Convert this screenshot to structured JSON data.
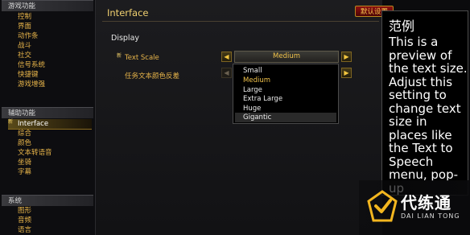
{
  "sidebar": {
    "section1": {
      "title": "游戏功能",
      "items": [
        "控制",
        "界面",
        "动作条",
        "战斗",
        "社交",
        "信号系统",
        "快捷键",
        "游戏增强"
      ]
    },
    "section2": {
      "title": "辅助功能",
      "new_badge": "新",
      "items": [
        "Interface",
        "综合",
        "颜色",
        "文本转语音",
        "坐骑",
        "字幕"
      ],
      "selected": "Interface"
    },
    "section3": {
      "title": "系统",
      "items": [
        "图形",
        "音频",
        "语言"
      ]
    }
  },
  "main": {
    "title": "Interface",
    "defaults_button": "默认设置",
    "display_header": "Display",
    "options": [
      {
        "label": "Text Scale",
        "new_badge": "新",
        "value": "Medium"
      },
      {
        "label": "任务文本颜色反差"
      }
    ],
    "dropdown": {
      "items": [
        "Small",
        "Medium",
        "Large",
        "Extra Large",
        "Huge",
        "Gigantic"
      ],
      "selected": "Medium",
      "hovered": "Gigantic"
    }
  },
  "tooltip": {
    "title": "范例",
    "body": "This is a preview of the text size. Adjust this setting to change text size in places like the Text to Speech menu, pop-up"
  },
  "watermark": {
    "cn": "代练通",
    "en": "DAI LIAN TONG"
  },
  "colors": {
    "accent_gold": "#e8b54a",
    "button_red": "#8b1010"
  }
}
